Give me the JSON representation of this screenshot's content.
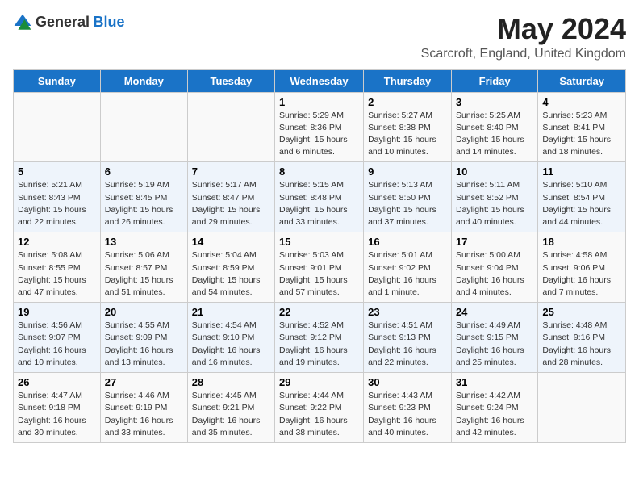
{
  "logo": {
    "general": "General",
    "blue": "Blue"
  },
  "title": "May 2024",
  "subtitle": "Scarcroft, England, United Kingdom",
  "days_of_week": [
    "Sunday",
    "Monday",
    "Tuesday",
    "Wednesday",
    "Thursday",
    "Friday",
    "Saturday"
  ],
  "weeks": [
    [
      {
        "day": "",
        "info": ""
      },
      {
        "day": "",
        "info": ""
      },
      {
        "day": "",
        "info": ""
      },
      {
        "day": "1",
        "info": "Sunrise: 5:29 AM\nSunset: 8:36 PM\nDaylight: 15 hours\nand 6 minutes."
      },
      {
        "day": "2",
        "info": "Sunrise: 5:27 AM\nSunset: 8:38 PM\nDaylight: 15 hours\nand 10 minutes."
      },
      {
        "day": "3",
        "info": "Sunrise: 5:25 AM\nSunset: 8:40 PM\nDaylight: 15 hours\nand 14 minutes."
      },
      {
        "day": "4",
        "info": "Sunrise: 5:23 AM\nSunset: 8:41 PM\nDaylight: 15 hours\nand 18 minutes."
      }
    ],
    [
      {
        "day": "5",
        "info": "Sunrise: 5:21 AM\nSunset: 8:43 PM\nDaylight: 15 hours\nand 22 minutes."
      },
      {
        "day": "6",
        "info": "Sunrise: 5:19 AM\nSunset: 8:45 PM\nDaylight: 15 hours\nand 26 minutes."
      },
      {
        "day": "7",
        "info": "Sunrise: 5:17 AM\nSunset: 8:47 PM\nDaylight: 15 hours\nand 29 minutes."
      },
      {
        "day": "8",
        "info": "Sunrise: 5:15 AM\nSunset: 8:48 PM\nDaylight: 15 hours\nand 33 minutes."
      },
      {
        "day": "9",
        "info": "Sunrise: 5:13 AM\nSunset: 8:50 PM\nDaylight: 15 hours\nand 37 minutes."
      },
      {
        "day": "10",
        "info": "Sunrise: 5:11 AM\nSunset: 8:52 PM\nDaylight: 15 hours\nand 40 minutes."
      },
      {
        "day": "11",
        "info": "Sunrise: 5:10 AM\nSunset: 8:54 PM\nDaylight: 15 hours\nand 44 minutes."
      }
    ],
    [
      {
        "day": "12",
        "info": "Sunrise: 5:08 AM\nSunset: 8:55 PM\nDaylight: 15 hours\nand 47 minutes."
      },
      {
        "day": "13",
        "info": "Sunrise: 5:06 AM\nSunset: 8:57 PM\nDaylight: 15 hours\nand 51 minutes."
      },
      {
        "day": "14",
        "info": "Sunrise: 5:04 AM\nSunset: 8:59 PM\nDaylight: 15 hours\nand 54 minutes."
      },
      {
        "day": "15",
        "info": "Sunrise: 5:03 AM\nSunset: 9:01 PM\nDaylight: 15 hours\nand 57 minutes."
      },
      {
        "day": "16",
        "info": "Sunrise: 5:01 AM\nSunset: 9:02 PM\nDaylight: 16 hours\nand 1 minute."
      },
      {
        "day": "17",
        "info": "Sunrise: 5:00 AM\nSunset: 9:04 PM\nDaylight: 16 hours\nand 4 minutes."
      },
      {
        "day": "18",
        "info": "Sunrise: 4:58 AM\nSunset: 9:06 PM\nDaylight: 16 hours\nand 7 minutes."
      }
    ],
    [
      {
        "day": "19",
        "info": "Sunrise: 4:56 AM\nSunset: 9:07 PM\nDaylight: 16 hours\nand 10 minutes."
      },
      {
        "day": "20",
        "info": "Sunrise: 4:55 AM\nSunset: 9:09 PM\nDaylight: 16 hours\nand 13 minutes."
      },
      {
        "day": "21",
        "info": "Sunrise: 4:54 AM\nSunset: 9:10 PM\nDaylight: 16 hours\nand 16 minutes."
      },
      {
        "day": "22",
        "info": "Sunrise: 4:52 AM\nSunset: 9:12 PM\nDaylight: 16 hours\nand 19 minutes."
      },
      {
        "day": "23",
        "info": "Sunrise: 4:51 AM\nSunset: 9:13 PM\nDaylight: 16 hours\nand 22 minutes."
      },
      {
        "day": "24",
        "info": "Sunrise: 4:49 AM\nSunset: 9:15 PM\nDaylight: 16 hours\nand 25 minutes."
      },
      {
        "day": "25",
        "info": "Sunrise: 4:48 AM\nSunset: 9:16 PM\nDaylight: 16 hours\nand 28 minutes."
      }
    ],
    [
      {
        "day": "26",
        "info": "Sunrise: 4:47 AM\nSunset: 9:18 PM\nDaylight: 16 hours\nand 30 minutes."
      },
      {
        "day": "27",
        "info": "Sunrise: 4:46 AM\nSunset: 9:19 PM\nDaylight: 16 hours\nand 33 minutes."
      },
      {
        "day": "28",
        "info": "Sunrise: 4:45 AM\nSunset: 9:21 PM\nDaylight: 16 hours\nand 35 minutes."
      },
      {
        "day": "29",
        "info": "Sunrise: 4:44 AM\nSunset: 9:22 PM\nDaylight: 16 hours\nand 38 minutes."
      },
      {
        "day": "30",
        "info": "Sunrise: 4:43 AM\nSunset: 9:23 PM\nDaylight: 16 hours\nand 40 minutes."
      },
      {
        "day": "31",
        "info": "Sunrise: 4:42 AM\nSunset: 9:24 PM\nDaylight: 16 hours\nand 42 minutes."
      },
      {
        "day": "",
        "info": ""
      }
    ]
  ]
}
